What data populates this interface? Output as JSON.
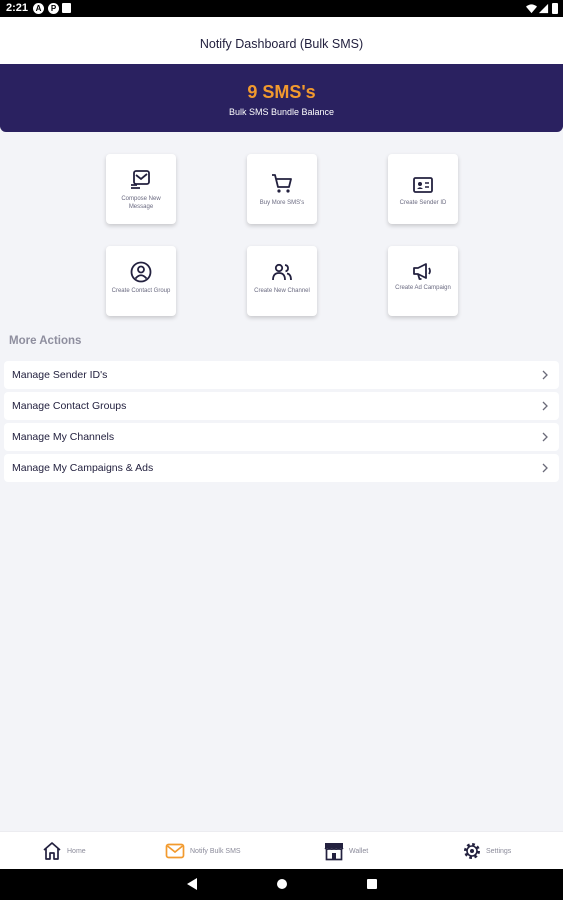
{
  "status_bar": {
    "time": "2:21"
  },
  "header": {
    "title": "Notify Dashboard (Bulk SMS)"
  },
  "balance": {
    "amount": "9 SMS's",
    "caption": "Bulk SMS Bundle Balance"
  },
  "actions": [
    {
      "label": "Compose New Message",
      "icon": "compose-message-icon"
    },
    {
      "label": "Buy More SMS's",
      "icon": "shopping-cart-icon"
    },
    {
      "label": "Create Sender ID",
      "icon": "id-card-icon"
    },
    {
      "label": "Create Contact Group",
      "icon": "contact-user-icon"
    },
    {
      "label": "Create New Channel",
      "icon": "users-icon"
    },
    {
      "label": "Create Ad Campaign",
      "icon": "megaphone-icon"
    }
  ],
  "more_actions": {
    "title": "More Actions",
    "items": [
      {
        "label": "Manage Sender ID's"
      },
      {
        "label": "Manage Contact Groups"
      },
      {
        "label": "Manage My Channels"
      },
      {
        "label": "Manage My Campaigns & Ads"
      }
    ]
  },
  "bottom_nav": [
    {
      "label": "Home",
      "icon": "home-icon"
    },
    {
      "label": "Notify Bulk SMS",
      "icon": "sms-mail-icon",
      "active": true
    },
    {
      "label": "Wallet",
      "icon": "wallet-store-icon"
    },
    {
      "label": "Settings",
      "icon": "gear-icon"
    }
  ],
  "colors": {
    "brand_purple": "#2a2160",
    "accent_orange": "#f29a2e",
    "text_dark": "#23213f",
    "background": "#f3f4f8"
  }
}
